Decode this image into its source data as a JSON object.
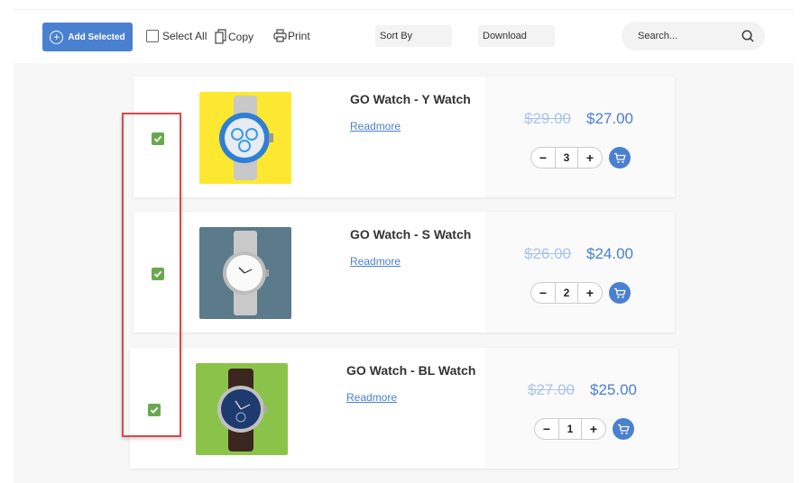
{
  "toolbar": {
    "add_selected_label": "Add Selected",
    "select_all_label": "Select All",
    "copy_label": "Copy",
    "print_label": "Print",
    "sort_by_label": "Sort By",
    "download_label": "Download",
    "search_placeholder": "Search..."
  },
  "products": [
    {
      "title": "GO Watch - Y Watch",
      "readmore": "Readmore",
      "old_price": "$29.00",
      "new_price": "$27.00",
      "quantity": "3",
      "checked": true,
      "image_bg": "#fde831"
    },
    {
      "title": "GO Watch - S Watch",
      "readmore": "Readmore",
      "old_price": "$26.00",
      "new_price": "$24.00",
      "quantity": "2",
      "checked": true,
      "image_bg": "#5b7a8a"
    },
    {
      "title": "GO Watch - BL Watch",
      "readmore": "Readmore",
      "old_price": "$27.00",
      "new_price": "$25.00",
      "quantity": "1",
      "checked": true,
      "image_bg": "#8bc34a"
    }
  ],
  "colors": {
    "accent": "#4a80d0",
    "checkbox": "#6aa84f",
    "highlight": "#e04646"
  }
}
